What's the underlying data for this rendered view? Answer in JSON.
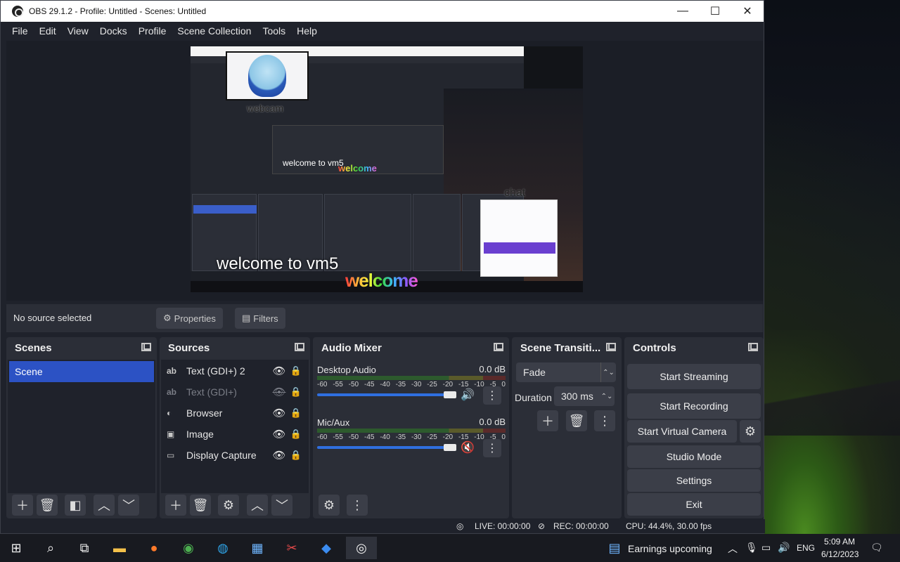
{
  "window": {
    "title": "OBS 29.1.2 - Profile: Untitled - Scenes: Untitled",
    "minimize": "—",
    "maximize": "☐",
    "close": "✕"
  },
  "menu": [
    "File",
    "Edit",
    "View",
    "Docks",
    "Profile",
    "Scene Collection",
    "Tools",
    "Help"
  ],
  "preview": {
    "overlay_webcam": "webcam",
    "overlay_chat": "chat",
    "overlay_welcome": "welcome to vm5",
    "overlay_welcome_small": "welcome to vm5",
    "overlay_rainbow": "welcome",
    "overlay_rainbow_small": "welcome"
  },
  "context": {
    "status": "No source selected",
    "properties": "Properties",
    "filters": "Filters"
  },
  "scenes": {
    "title": "Scenes",
    "items": [
      "Scene"
    ]
  },
  "sources": {
    "title": "Sources",
    "items": [
      {
        "name": "Text (GDI+) 2",
        "icon": "text-icon",
        "glyph": "ab",
        "visible": true
      },
      {
        "name": "Text (GDI+)",
        "icon": "text-icon",
        "glyph": "ab",
        "visible": false
      },
      {
        "name": "Browser",
        "icon": "globe-icon",
        "glyph": "◐",
        "visible": true
      },
      {
        "name": "Image",
        "icon": "image-icon",
        "glyph": "▣",
        "visible": true
      },
      {
        "name": "Display Capture",
        "icon": "monitor-icon",
        "glyph": "▭",
        "visible": true
      }
    ]
  },
  "mixer": {
    "title": "Audio Mixer",
    "scale": [
      "-60",
      "-55",
      "-50",
      "-45",
      "-40",
      "-35",
      "-30",
      "-25",
      "-20",
      "-15",
      "-10",
      "-5",
      "0"
    ],
    "tracks": [
      {
        "name": "Desktop Audio",
        "db": "0.0 dB",
        "muted": false
      },
      {
        "name": "Mic/Aux",
        "db": "0.0 dB",
        "muted": true
      }
    ]
  },
  "transitions": {
    "title": "Scene Transiti...",
    "selected": "Fade",
    "duration_label": "Duration",
    "duration_value": "300 ms"
  },
  "controls": {
    "title": "Controls",
    "start_streaming": "Start Streaming",
    "start_recording": "Start Recording",
    "start_virtual_camera": "Start Virtual Camera",
    "studio_mode": "Studio Mode",
    "settings": "Settings",
    "exit": "Exit"
  },
  "status": {
    "live": "LIVE: 00:00:00",
    "rec": "REC: 00:00:00",
    "cpu": "CPU: 44.4%, 30.00 fps"
  },
  "taskbar": {
    "news": "Earnings upcoming",
    "lang": "ENG",
    "time": "5:09 AM",
    "date": "6/12/2023"
  },
  "colors": {
    "accent": "#2c52c4",
    "panel": "#2b2e37",
    "background": "#1f222b",
    "muted_red": "#d23c3c"
  }
}
